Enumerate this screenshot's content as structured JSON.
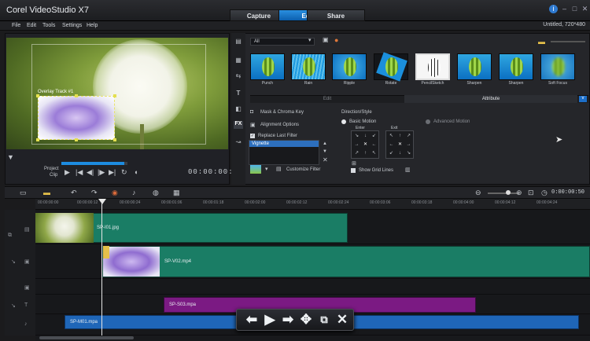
{
  "app": {
    "title": "Corel VideoStudio X7",
    "project_info": "Untitled, 720*480"
  },
  "mode_tabs": [
    "Capture",
    "Edit",
    "Share"
  ],
  "menu": [
    "File",
    "Edit",
    "Tools",
    "Settings",
    "Help"
  ],
  "player": {
    "overlay_label": "Overlay Track #1",
    "mode_project": "Project",
    "mode_clip": "Clip",
    "timecode": "00:00:00:12"
  },
  "library": {
    "filter_dropdown": "All",
    "thumbnails": [
      {
        "label": "Punch"
      },
      {
        "label": "Rain"
      },
      {
        "label": "Ripple"
      },
      {
        "label": "Rotate"
      },
      {
        "label": "PencilSketch"
      },
      {
        "label": "Sharpen"
      },
      {
        "label": "Sharpen"
      },
      {
        "label": "Soft Focus"
      }
    ],
    "subtabs": {
      "edit": "Edit",
      "attribute": "Attribute"
    },
    "options": {
      "mask_chroma": "Mask & Chroma Key",
      "alignment": "Alignment Options",
      "replace_last_filter": "Replace Last Filter",
      "filter_item": "Vignette",
      "customize_filter": "Customize Filter",
      "direction_style": "Direction/Style",
      "basic_motion": "Basic Motion",
      "advanced_motion": "Advanced Motion",
      "enter": "Enter",
      "exit": "Exit",
      "show_grid_lines": "Show Grid Lines"
    }
  },
  "timeline": {
    "timecode": "0:00:00:50",
    "ruler": [
      "00:00:00:00",
      "00:00:00:12",
      "00:00:00:24",
      "00:00:01:06",
      "00:00:01:18",
      "00:00:02:00",
      "00:00:02:12",
      "00:00:02:24",
      "00:00:03:06",
      "00:00:03:18",
      "00:00:04:00",
      "00:00:04:12",
      "00:00:04:24"
    ],
    "clips": {
      "video": "SP-I01.jpg",
      "overlay": "SP-V02.mp4",
      "title": "SP-S03.mpa",
      "music": "SP-M01.mpa"
    }
  },
  "colors": {
    "accent": "#1d8ce0",
    "video_clip": "#1a7d65",
    "title_clip": "#7b1a83",
    "music_clip": "#1f66b8"
  }
}
